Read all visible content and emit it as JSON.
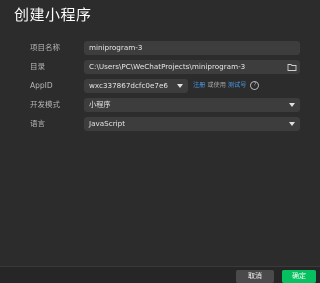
{
  "dialog": {
    "title": "创建小程序"
  },
  "form": {
    "project_name": {
      "label": "项目名称",
      "value": "miniprogram-3"
    },
    "directory": {
      "label": "目录",
      "value": "C:\\Users\\PC\\WeChatProjects\\miniprogram-3",
      "icon": "folder-icon"
    },
    "appid": {
      "label": "AppID",
      "value": "wxc337867dcfc0e7e6",
      "register_link": "注册",
      "or_text": "或使用",
      "test_link": "测试号",
      "help_icon": "?"
    },
    "dev_mode": {
      "label": "开发模式",
      "value": "小程序"
    },
    "language": {
      "label": "语言",
      "value": "JavaScript"
    }
  },
  "footer": {
    "cancel_label": "取消",
    "confirm_label": "确定"
  },
  "colors": {
    "background": "#2c2c2c",
    "field_bg": "#3d3d3d",
    "link": "#4d9df0",
    "primary": "#07c160"
  }
}
